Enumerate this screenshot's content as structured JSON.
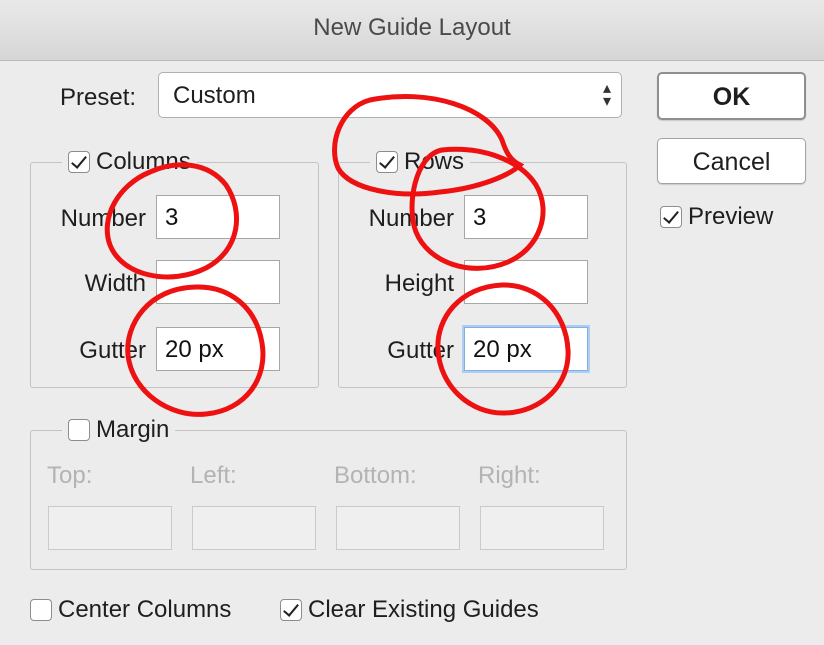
{
  "window": {
    "title": "New Guide Layout"
  },
  "preset": {
    "label": "Preset:",
    "value": "Custom"
  },
  "buttons": {
    "ok": "OK",
    "cancel": "Cancel"
  },
  "preview": {
    "label": "Preview",
    "checked": true
  },
  "columns": {
    "label": "Columns",
    "checked": true,
    "number_label": "Number",
    "number_value": "3",
    "width_label": "Width",
    "width_value": "",
    "gutter_label": "Gutter",
    "gutter_value": "20 px"
  },
  "rows": {
    "label": "Rows",
    "checked": true,
    "number_label": "Number",
    "number_value": "3",
    "height_label": "Height",
    "height_value": "",
    "gutter_label": "Gutter",
    "gutter_value": "20 px"
  },
  "margin": {
    "label": "Margin",
    "checked": false,
    "top_label": "Top:",
    "left_label": "Left:",
    "bottom_label": "Bottom:",
    "right_label": "Right:"
  },
  "footer": {
    "center_columns": "Center Columns",
    "center_columns_checked": false,
    "clear_guides": "Clear Existing Guides",
    "clear_guides_checked": true
  },
  "colors": {
    "annotation": "#ee1111",
    "focus_ring": "#aecdf2"
  }
}
